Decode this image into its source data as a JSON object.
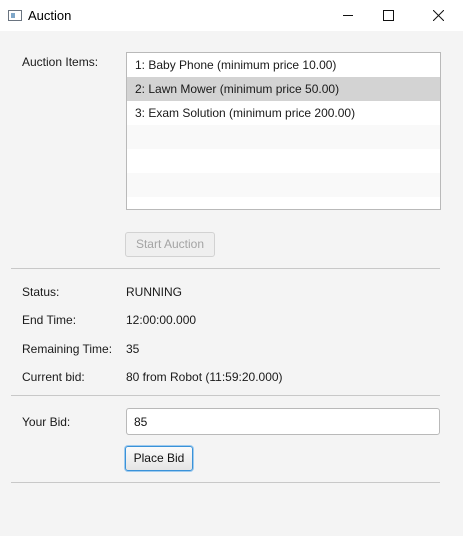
{
  "window": {
    "title": "Auction",
    "icons": {
      "app": "app-window-icon",
      "minimize": "minimize-icon",
      "maximize": "maximize-icon",
      "close": "close-icon"
    }
  },
  "auction_items": {
    "label": "Auction Items:",
    "items": [
      {
        "label": "1: Baby Phone (minimum price 10.00)",
        "selected": false
      },
      {
        "label": "2: Lawn Mower (minimum price 50.00)",
        "selected": true
      },
      {
        "label": "3: Exam Solution (minimum price 200.00)",
        "selected": false
      }
    ],
    "start_button": {
      "label": "Start Auction",
      "enabled": false
    }
  },
  "status": {
    "status_label": "Status:",
    "status_value": "RUNNING",
    "end_time_label": "End Time:",
    "end_time_value": "12:00:00.000",
    "remaining_label": "Remaining Time:",
    "remaining_value": "35",
    "current_bid_label": "Current bid:",
    "current_bid_value": "80 from Robot (11:59:20.000)"
  },
  "bid": {
    "label": "Your Bid:",
    "value": "85",
    "place_button": "Place Bid"
  },
  "colors": {
    "selection": "#d3d3d3",
    "focus_border": "#3a92d8",
    "disabled_text": "#a4a4a4"
  }
}
